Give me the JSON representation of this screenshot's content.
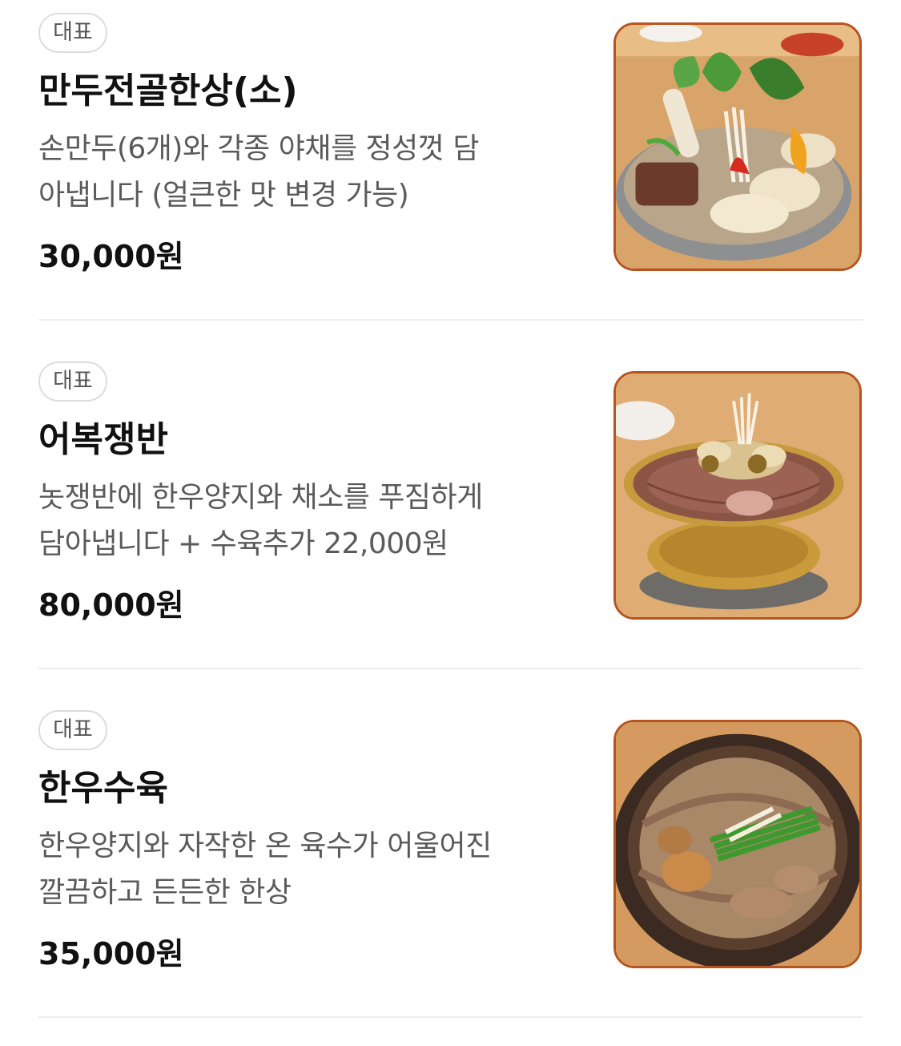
{
  "menu": {
    "items": [
      {
        "badge": "대표",
        "name": "만두전골한상(소)",
        "description_lines": [
          "손만두(6개)와 각종 야채를 정성껏 담",
          "아냅니다 (얼큰한 맛 변경 가능)"
        ],
        "price": "30,000원",
        "photo_icon": "dumpling-hotpot-photo"
      },
      {
        "badge": "대표",
        "name": "어복쟁반",
        "description_lines": [
          "놋쟁반에 한우양지와 채소를 푸짐하게",
          "담아냅니다 + 수육추가 22,000원"
        ],
        "price": "80,000원",
        "photo_icon": "brass-tray-beef-photo"
      },
      {
        "badge": "대표",
        "name": "한우수육",
        "description_lines": [
          "한우양지와 자작한 온 육수가 어울어진",
          "깔끔하고 든든한 한상"
        ],
        "price": "35,000원",
        "photo_icon": "boiled-beef-pot-photo"
      }
    ]
  }
}
